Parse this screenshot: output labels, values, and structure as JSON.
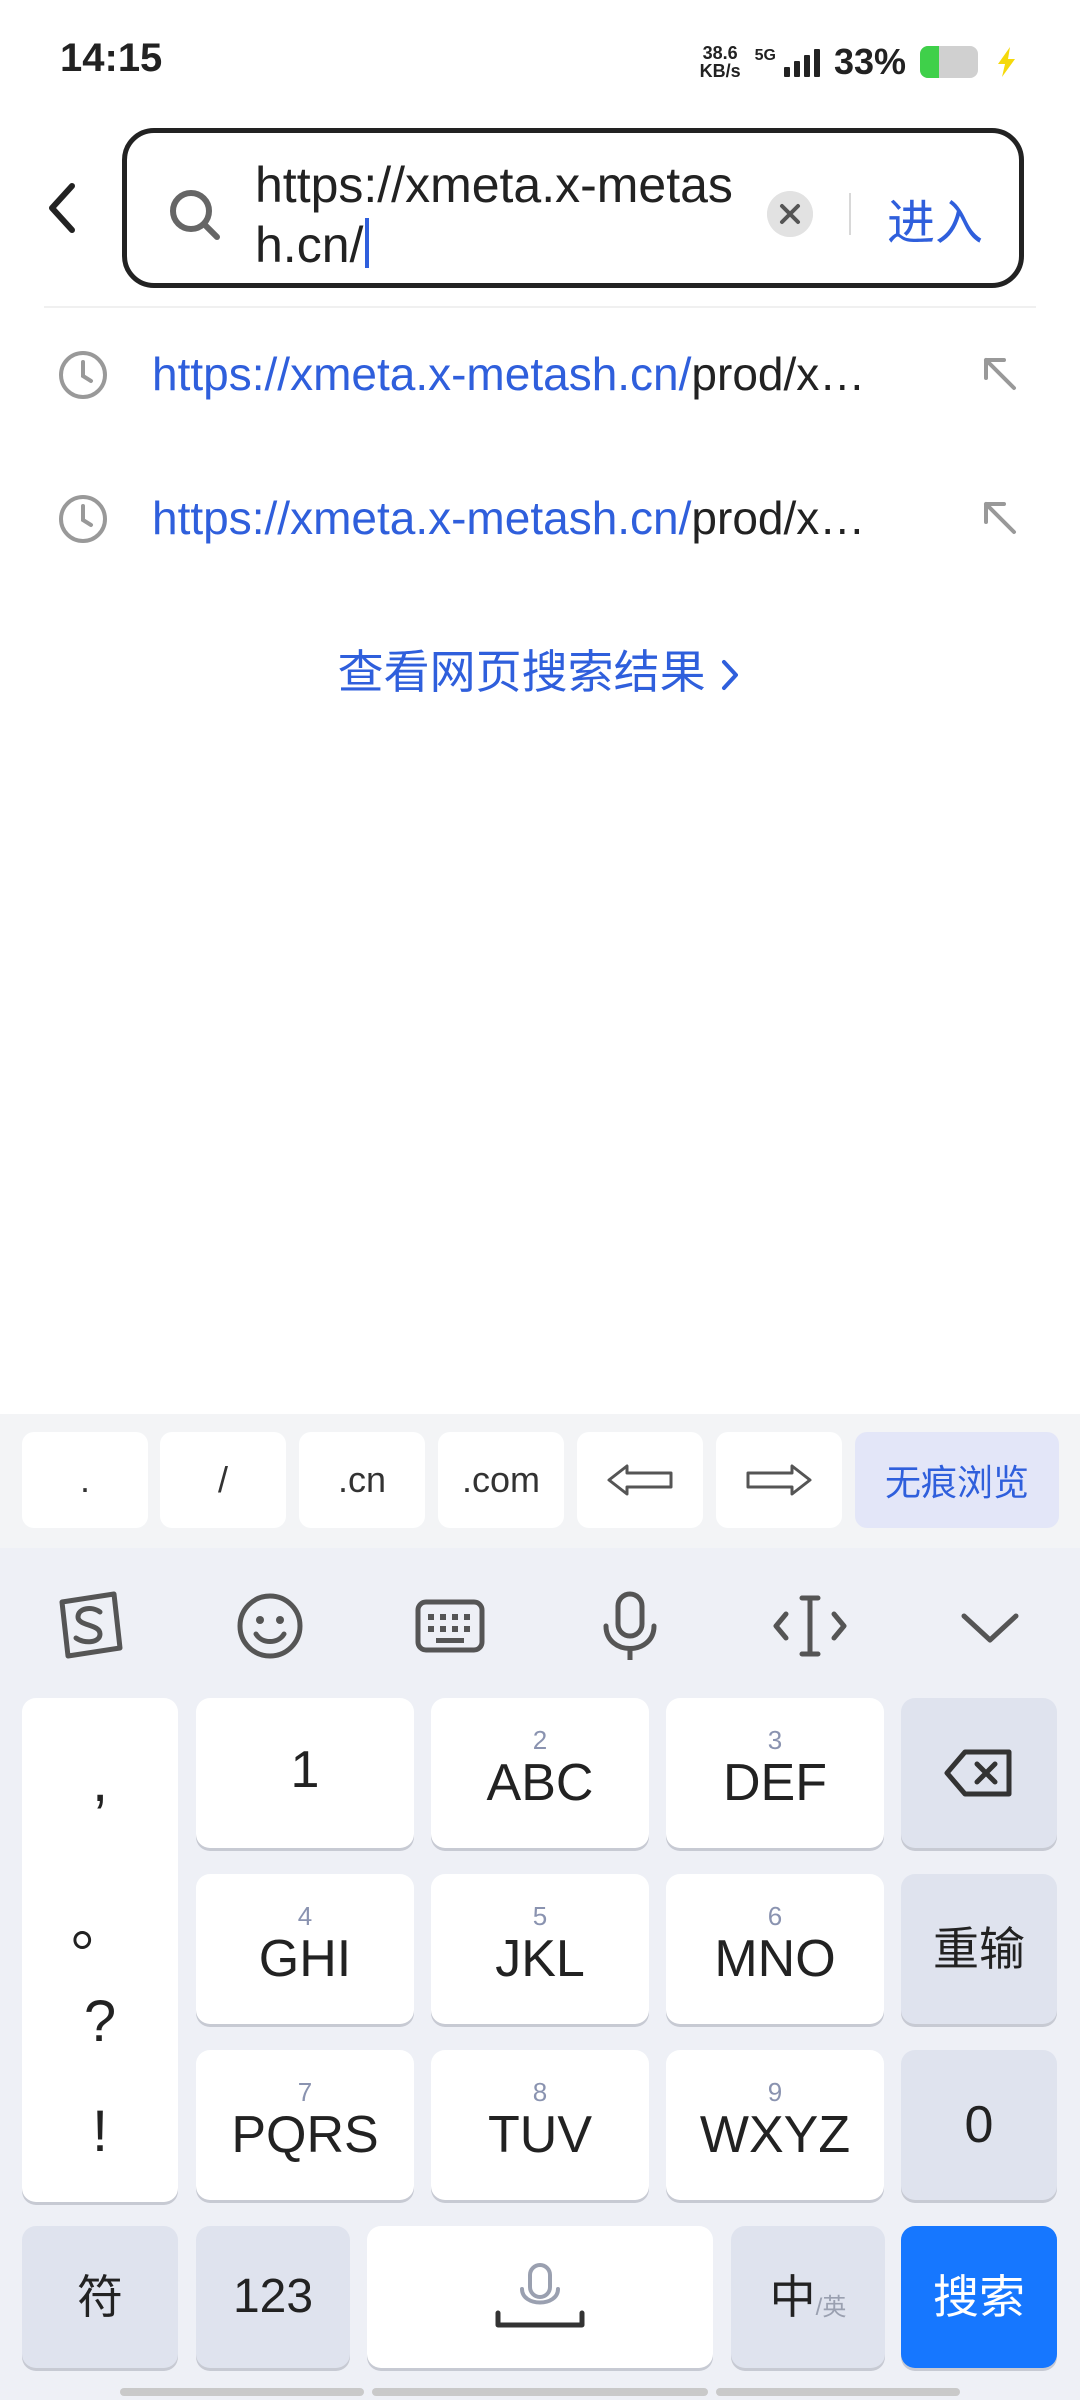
{
  "status_bar": {
    "time": "14:15",
    "net_speed_value": "38.6",
    "net_speed_unit": "KB/s",
    "network": "5G",
    "battery_percent": "33%",
    "battery_level": 0.33
  },
  "search": {
    "url_text": "https://xmeta.x-metash.cn/",
    "enter_label": "进入"
  },
  "suggestions": [
    {
      "highlight": "https://xmeta.x-metash.cn/",
      "rest": "prod/x…"
    },
    {
      "highlight": "https://xmeta.x-metash.cn/",
      "rest": "prod/x…"
    }
  ],
  "web_results_label": "查看网页搜索结果",
  "keyboard": {
    "quick_keys": [
      ".",
      "/",
      ".cn",
      ".com"
    ],
    "private_browse_label": "无痕浏览",
    "punctuation": [
      ",",
      "。",
      "?",
      "!"
    ],
    "keys_row1": [
      {
        "num": "",
        "label": "1"
      },
      {
        "num": "2",
        "label": "ABC"
      },
      {
        "num": "3",
        "label": "DEF"
      }
    ],
    "keys_row2": [
      {
        "num": "4",
        "label": "GHI"
      },
      {
        "num": "5",
        "label": "JKL"
      },
      {
        "num": "6",
        "label": "MNO"
      }
    ],
    "keys_row3": [
      {
        "num": "7",
        "label": "PQRS"
      },
      {
        "num": "8",
        "label": "TUV"
      },
      {
        "num": "9",
        "label": "WXYZ"
      }
    ],
    "retype_label": "重输",
    "zero_label": "0",
    "symbol_label": "符",
    "num_label": "123",
    "lang_label": "中",
    "lang_alt_label": "/英",
    "search_label": "搜索"
  },
  "colors": {
    "accent": "#2f5fdc",
    "search_key": "#1677ff",
    "battery_fill": "#3fd04a"
  }
}
